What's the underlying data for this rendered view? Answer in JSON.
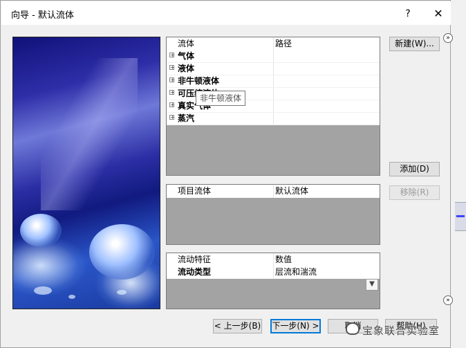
{
  "dialog": {
    "title": "向导 - 默认流体",
    "help_label": "?",
    "close_label": "✕"
  },
  "fluids_panel": {
    "col1": "流体",
    "col2": "路径",
    "items": [
      "气体",
      "液体",
      "非牛顿液体",
      "可压缩液体",
      "真实气体",
      "蒸汽"
    ],
    "tooltip": "非牛顿液体"
  },
  "project_panel": {
    "col1": "项目流体",
    "col2": "默认流体"
  },
  "flow_panel": {
    "col1": "流动特征",
    "col2": "数值",
    "row_label": "流动类型",
    "row_value": "层流和湍流"
  },
  "buttons": {
    "new": "新建(W)...",
    "add": "添加(D)",
    "remove": "移除(R)",
    "back": "< 上一步(B)",
    "next": "下一步(N) >",
    "cancel": "取消",
    "help": "帮助(H)"
  },
  "side_icons": {
    "top": "»",
    "bottom": "»"
  },
  "watermark": "宝象联合实验室",
  "icons": [
    "help-icon",
    "close-icon",
    "expand-icon",
    "dropdown-arrow-icon",
    "expand-side-icon"
  ]
}
